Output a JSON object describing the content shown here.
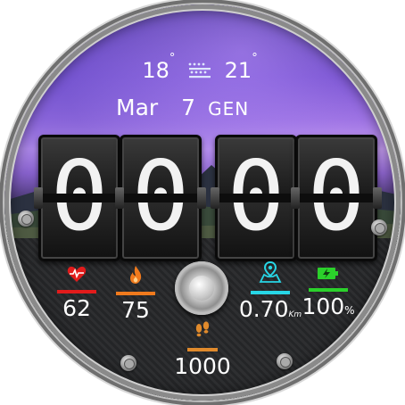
{
  "weather": {
    "low": "18",
    "high": "21",
    "degree_symbol": "°",
    "icon": "fog-icon"
  },
  "date": {
    "month": "Mar",
    "day": "7",
    "weekday": "GEN"
  },
  "time": {
    "digits": [
      "0",
      "0",
      "0",
      "0"
    ]
  },
  "stats": {
    "heart_rate": {
      "icon": "heart-rate-icon",
      "value": "62",
      "color": "#e21b1b"
    },
    "calories": {
      "icon": "flame-icon",
      "value": "75",
      "color": "#f07a1d"
    },
    "distance": {
      "icon": "map-pin-icon",
      "value": "0.70",
      "unit": "Km",
      "color": "#27d6e6"
    },
    "battery": {
      "icon": "battery-charging-icon",
      "value": "100",
      "unit": "%",
      "color": "#2bd12b"
    },
    "steps": {
      "icon": "footsteps-icon",
      "value": "1000",
      "color": "#e08a2c"
    }
  }
}
